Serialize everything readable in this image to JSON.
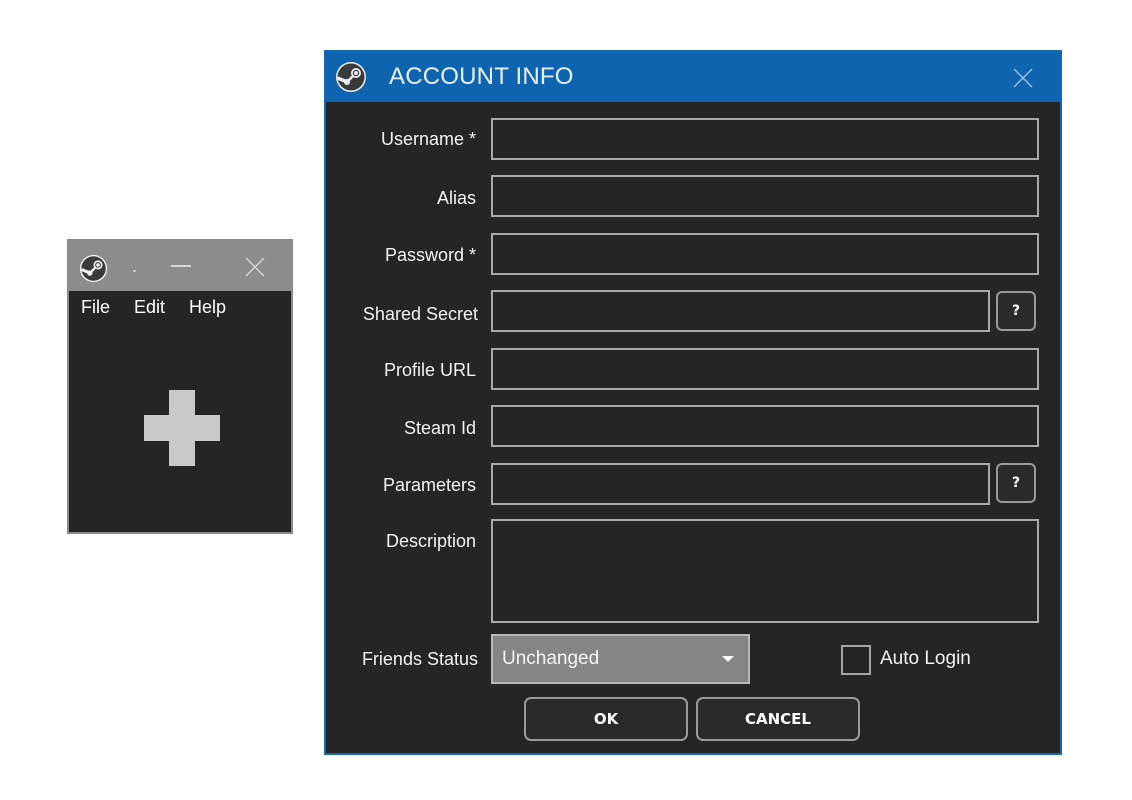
{
  "main_window": {
    "title": ".",
    "logo_icon": "steam-logo-icon",
    "minimize_icon": "minimize-icon",
    "close_icon": "close-icon",
    "menu": [
      {
        "label": "File"
      },
      {
        "label": "Edit"
      },
      {
        "label": "Help"
      }
    ],
    "add_icon": "plus-icon"
  },
  "dialog": {
    "title": "ACCOUNT INFO",
    "logo_icon": "steam-logo-icon",
    "close_icon": "close-icon",
    "accent_color": "#0f64b0",
    "fields": {
      "username": {
        "label": "Username *",
        "value": ""
      },
      "alias": {
        "label": "Alias",
        "value": ""
      },
      "password": {
        "label": "Password *",
        "value": ""
      },
      "shared_secret": {
        "label": "Shared Secret",
        "value": "",
        "help_label": "?"
      },
      "profile_url": {
        "label": "Profile URL",
        "value": ""
      },
      "steam_id": {
        "label": "Steam Id",
        "value": ""
      },
      "parameters": {
        "label": "Parameters",
        "value": "",
        "help_label": "?"
      },
      "description": {
        "label": "Description",
        "value": ""
      }
    },
    "friends_status": {
      "label": "Friends Status",
      "selected": "Unchanged"
    },
    "auto_login": {
      "label": "Auto Login",
      "checked": false
    },
    "buttons": {
      "ok": "OK",
      "cancel": "CANCEL"
    }
  }
}
